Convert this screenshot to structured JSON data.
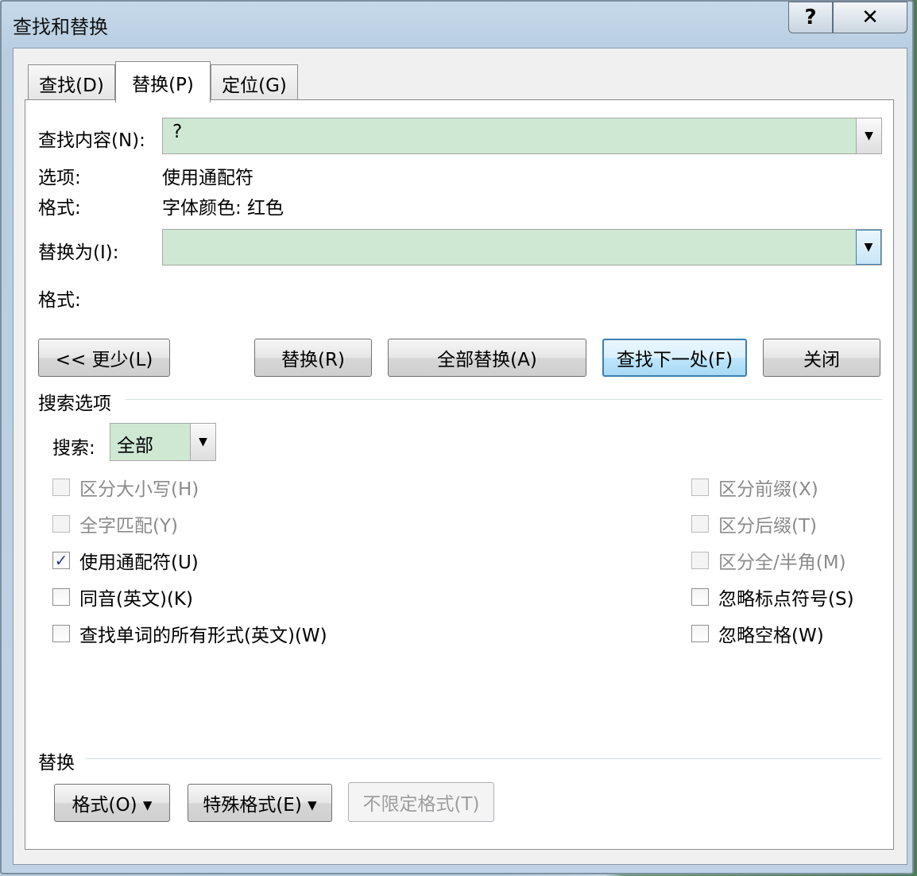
{
  "window": {
    "title": "查找和替换",
    "help_label": "?",
    "close_label": "✕"
  },
  "tabs": [
    {
      "label": "查找(D)"
    },
    {
      "label": "替换(P)"
    },
    {
      "label": "定位(G)"
    }
  ],
  "find": {
    "label": "查找内容(N):",
    "value": "?",
    "options_label": "选项:",
    "options_value": "使用通配符",
    "format_label": "格式:",
    "format_value": "字体颜色: 红色"
  },
  "replace": {
    "label": "替换为(I):",
    "value": "",
    "format_label": "格式:"
  },
  "buttons": {
    "less": "<< 更少(L)",
    "replace": "替换(R)",
    "replace_all": "全部替换(A)",
    "find_next": "查找下一处(F)",
    "close": "关闭"
  },
  "search_options": {
    "heading": "搜索选项",
    "search_label": "搜索:",
    "search_value": "全部",
    "left": [
      {
        "label": "区分大小写(H)",
        "checked": false,
        "enabled": false
      },
      {
        "label": "全字匹配(Y)",
        "checked": false,
        "enabled": false
      },
      {
        "label": "使用通配符(U)",
        "checked": true,
        "enabled": true
      },
      {
        "label": "同音(英文)(K)",
        "checked": false,
        "enabled": true
      },
      {
        "label": "查找单词的所有形式(英文)(W)",
        "checked": false,
        "enabled": true
      }
    ],
    "right": [
      {
        "label": "区分前缀(X)",
        "checked": false,
        "enabled": false
      },
      {
        "label": "区分后缀(T)",
        "checked": false,
        "enabled": false
      },
      {
        "label": "区分全/半角(M)",
        "checked": false,
        "enabled": false
      },
      {
        "label": "忽略标点符号(S)",
        "checked": false,
        "enabled": true
      },
      {
        "label": "忽略空格(W)",
        "checked": false,
        "enabled": true
      }
    ]
  },
  "replace_section": {
    "heading": "替换",
    "format_button": "格式(O) ▾",
    "special_button": "特殊格式(E) ▾",
    "no_format_button": "不限定格式(T)"
  },
  "check_glyph": "✓"
}
